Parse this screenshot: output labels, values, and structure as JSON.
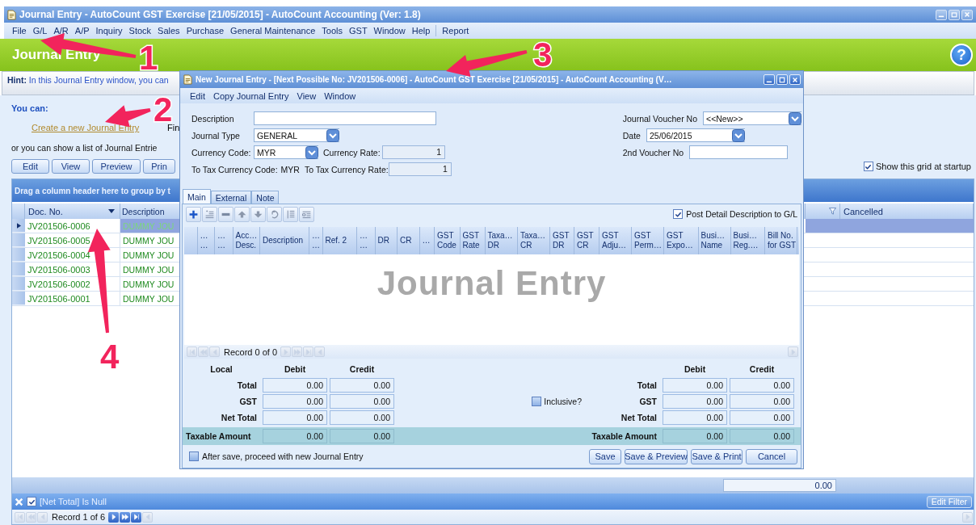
{
  "main_window": {
    "title": "Journal Entry - AutoCount GST Exercise [21/05/2015] - AutoCount Accounting (Ver: 1.8)",
    "menu": [
      "File",
      "G/L",
      "A/R",
      "A/P",
      "Inquiry",
      "Stock",
      "Sales",
      "Purchase",
      "General Maintenance",
      "Tools",
      "GST",
      "Window",
      "Help",
      "Report"
    ],
    "header": {
      "title": "Journal Entry",
      "help": "?"
    },
    "hint": "**Hint:** In this Journal Entry window, you can",
    "you_can": "You can:",
    "create_link": "Create a new Journal Entry",
    "find_text": "Fin",
    "list_text": "or you can show a list of Journal Entrie",
    "actions": [
      "Edit",
      "View",
      "Preview",
      "Prin"
    ],
    "show_grid": {
      "label": "Show this grid at startup",
      "checked": true
    },
    "grid": {
      "group_hint": "Drag a column header here to group by t",
      "columns": [
        "Doc. No.",
        "Description",
        "Cancelled"
      ],
      "rows": [
        {
          "doc_no": "JV201506-0006",
          "description": "DUMMY JOU",
          "selected": true
        },
        {
          "doc_no": "JV201506-0005",
          "description": "DUMMY JOU",
          "selected": false
        },
        {
          "doc_no": "JV201506-0004",
          "description": "DUMMY JOU",
          "selected": false
        },
        {
          "doc_no": "JV201506-0003",
          "description": "DUMMY JOU",
          "selected": false
        },
        {
          "doc_no": "JV201506-0002",
          "description": "DUMMY JOU",
          "selected": false
        },
        {
          "doc_no": "JV201506-0001",
          "description": "DUMMY JOU",
          "selected": false
        }
      ],
      "summary": "0.00",
      "filter": {
        "text": "[Net Total] Is Null",
        "checked": true
      },
      "edit_filter": "Edit Filter",
      "record": "Record 1 of 6"
    }
  },
  "dialog": {
    "title": "New Journal Entry - [Next Possible No: JV201506-0006] - AutoCount GST Exercise [21/05/2015] - AutoCount Accounting (V…",
    "menu": [
      "Edit",
      "Copy Journal Entry",
      "View",
      "Window"
    ],
    "form_left": [
      {
        "kind": "text",
        "label": "Description"
      },
      {
        "kind": "combo",
        "label": "Journal Type",
        "value": "GENERAL"
      },
      {
        "kind": "combo",
        "label": "Currency Code:",
        "value": "MYR",
        "rate_label": "Currency Rate:",
        "rate": "1"
      },
      {
        "kind": "plain",
        "label": "To Tax Currency Code:",
        "value": "MYR",
        "rate_label": "To Tax Currency Rate:",
        "rate": "1"
      }
    ],
    "form_right": [
      {
        "kind": "combo",
        "label": "Journal Voucher No",
        "value": "<<New>>"
      },
      {
        "kind": "combo",
        "label": "Date",
        "value": "25/06/2015"
      },
      {
        "kind": "text",
        "label": "2nd Voucher No"
      }
    ],
    "tabs": [
      {
        "label": "Main",
        "selected": true
      },
      {
        "label": "External",
        "selected": false
      },
      {
        "label": "Note",
        "selected": false
      }
    ],
    "post_detail": {
      "label": "Post Detail Description to G/L",
      "checked": true
    },
    "columns": [
      [
        "…",
        "…"
      ],
      [
        "…",
        "…"
      ],
      [
        "Acc…",
        "Desc."
      ],
      [
        "Description"
      ],
      [
        "…",
        "…"
      ],
      [
        "Ref. 2"
      ],
      [
        "…",
        "…"
      ],
      [
        "DR"
      ],
      [
        "CR"
      ],
      [
        "…"
      ],
      [
        "GST",
        "Code"
      ],
      [
        "GST",
        "Rate"
      ],
      [
        "Taxa…",
        "DR"
      ],
      [
        "Taxa…",
        "CR"
      ],
      [
        "GST",
        "DR"
      ],
      [
        "GST",
        "CR"
      ],
      [
        "GST",
        "Adju…"
      ],
      [
        "GST",
        "Perm…"
      ],
      [
        "GST",
        "Expo…"
      ],
      [
        "Busi…",
        "Name"
      ],
      [
        "Busi…",
        "Reg.…"
      ],
      [
        "Bill No.",
        "for GST"
      ]
    ],
    "watermark": "Journal Entry",
    "record": "Record 0 of 0",
    "totals": {
      "local_label": "Local",
      "debit_label": "Debit",
      "credit_label": "Credit",
      "right_debit_label": "Debit",
      "right_credit_label": "Credit",
      "left": [
        {
          "kind": "amount",
          "label": "Total",
          "debit": "0.00",
          "credit": "0.00"
        },
        {
          "kind": "amount",
          "label": "GST",
          "debit": "0.00",
          "credit": "0.00"
        },
        {
          "kind": "amount",
          "label": "Net Total",
          "debit": "0.00",
          "credit": "0.00"
        },
        {
          "kind": "taxable",
          "label": "Taxable Amount",
          "debit": "0.00",
          "credit": "0.00"
        }
      ],
      "right": [
        {
          "kind": "amount",
          "label": "Total",
          "debit": "0.00",
          "credit": "0.00"
        },
        {
          "kind": "amount",
          "label": "GST",
          "debit": "0.00",
          "credit": "0.00"
        },
        {
          "kind": "amount",
          "label": "Net Total",
          "debit": "0.00",
          "credit": "0.00"
        },
        {
          "kind": "taxable",
          "label": "Taxable Amount",
          "debit": "0.00",
          "credit": "0.00"
        }
      ],
      "inclusive": {
        "label": "Inclusive?",
        "checked": false
      }
    },
    "after_save": {
      "label": "After save, proceed with new Journal Entry",
      "checked": false
    },
    "buttons": [
      "Save",
      "Save & Preview",
      "Save & Print",
      "Cancel"
    ]
  },
  "annotations": [
    {
      "label": "1"
    },
    {
      "label": "2"
    },
    {
      "label": "3"
    },
    {
      "label": "4"
    }
  ]
}
